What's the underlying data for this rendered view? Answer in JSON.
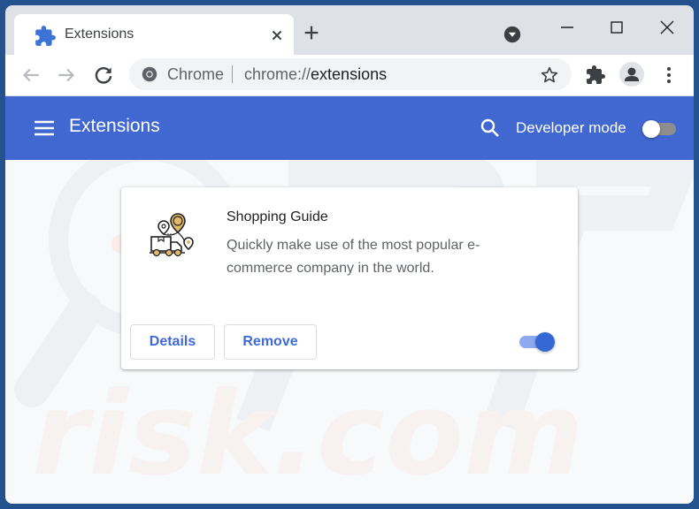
{
  "browser": {
    "tab": {
      "title": "Extensions",
      "icon": "puzzle-piece-icon"
    },
    "new_tab_icon": "plus-icon",
    "tab_search_icon": "dropdown-circle-icon",
    "window_controls": [
      "minimize",
      "maximize",
      "close"
    ],
    "omnibox": {
      "chip_label": "Chrome",
      "url_scheme": "chrome://",
      "url_host": "extensions"
    },
    "toolbar_icons": [
      "back-arrow-icon",
      "forward-arrow-icon",
      "reload-icon",
      "star-icon",
      "extensions-puzzle-icon",
      "profile-avatar-icon",
      "kebab-menu-icon"
    ]
  },
  "header": {
    "title": "Extensions",
    "developer_mode_label": "Developer mode",
    "developer_mode_enabled": false
  },
  "extension": {
    "name": "Shopping Guide",
    "description": "Quickly make use of the most popular e-commerce company in the world.",
    "details_label": "Details",
    "remove_label": "Remove",
    "enabled": true
  },
  "watermark": {
    "text": "risk.com"
  },
  "colors": {
    "header_blue": "#4168d0",
    "accent_blue": "#3f6ad8",
    "toggle_on_knob": "#3568d4",
    "toggle_on_track": "#8daaf0",
    "icon_gold": "#e0b86a"
  }
}
